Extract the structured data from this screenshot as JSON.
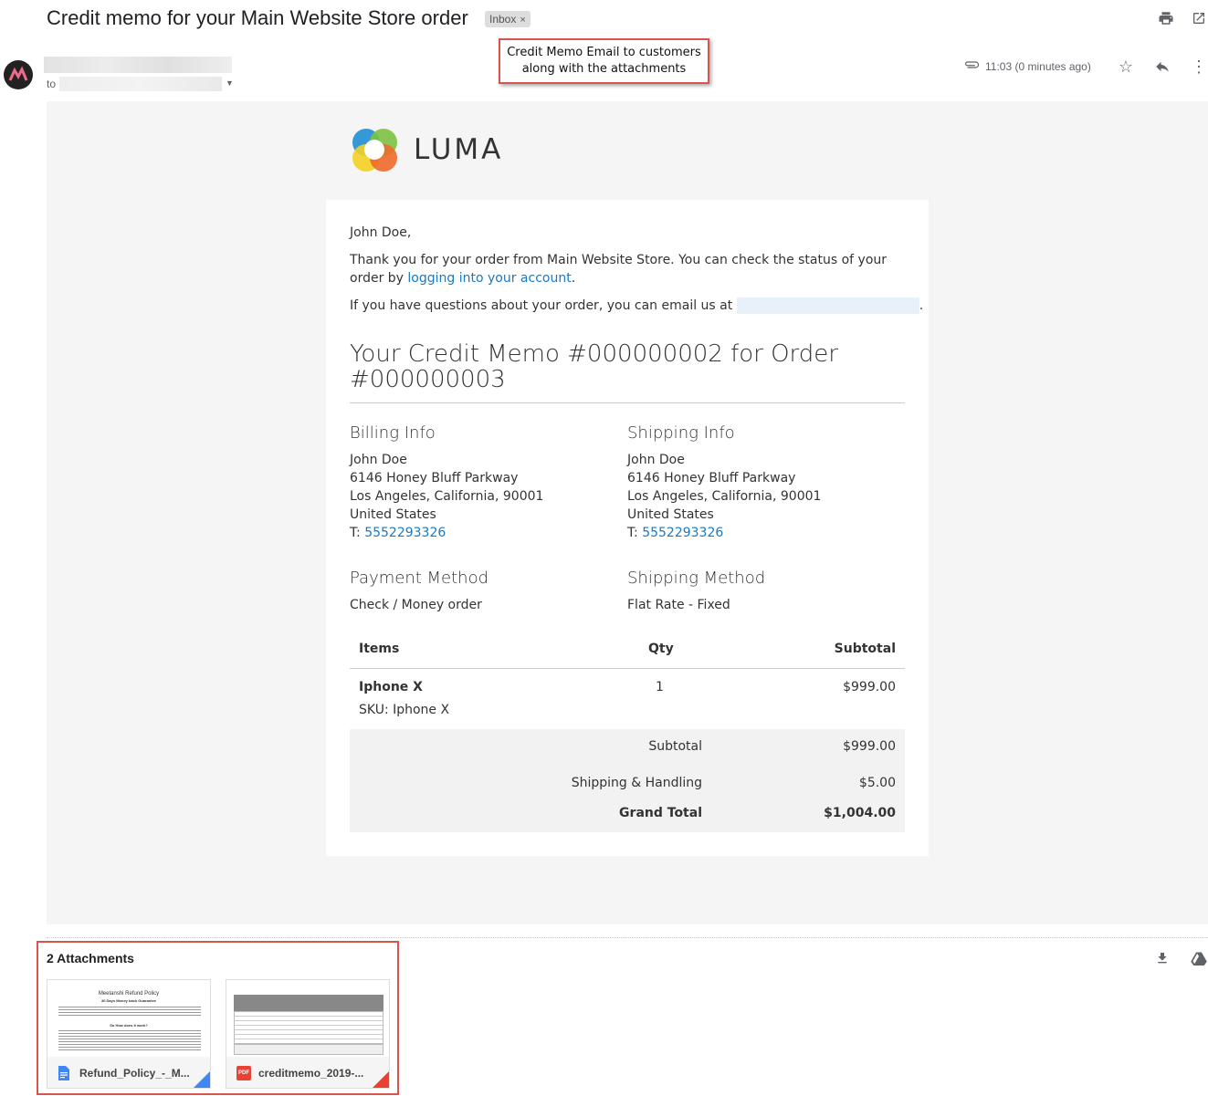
{
  "email": {
    "subject": "Credit memo for your Main Website Store order",
    "label": "Inbox",
    "label_close": "×",
    "to_prefix": "to",
    "time": "11:03 (0 minutes ago)"
  },
  "callout": {
    "line1": "Credit Memo Email to customers",
    "line2": "along with the attachments"
  },
  "logo": {
    "text": "LUMA"
  },
  "body": {
    "greeting": "John Doe,",
    "thanks": "Thank you for your order from Main Website Store. You can check the status of your order by",
    "login_link": "logging into your account",
    "login_suffix": ".",
    "questions": "If you have questions about your order, you can email us at",
    "questions_suffix": ".",
    "memo_title": "Your Credit Memo #000000002 for Order #000000003"
  },
  "billing": {
    "heading": "Billing Info",
    "name": "John Doe",
    "street": "6146 Honey Bluff Parkway",
    "city": "Los Angeles, California, 90001",
    "country": "United States",
    "phone_prefix": "T:",
    "phone": "5552293326"
  },
  "shipping": {
    "heading": "Shipping Info",
    "name": "John Doe",
    "street": "6146 Honey Bluff Parkway",
    "city": "Los Angeles, California, 90001",
    "country": "United States",
    "phone_prefix": "T:",
    "phone": "5552293326"
  },
  "payment": {
    "heading": "Payment Method",
    "value": "Check / Money order"
  },
  "shipping_method": {
    "heading": "Shipping Method",
    "value": "Flat Rate - Fixed"
  },
  "table": {
    "headers": {
      "items": "Items",
      "qty": "Qty",
      "subtotal": "Subtotal"
    },
    "row": {
      "name": "Iphone X",
      "sku": "SKU: Iphone X",
      "qty": "1",
      "subtotal": "$999.00"
    },
    "totals": {
      "subtotal_label": "Subtotal",
      "subtotal_value": "$999.00",
      "shipping_label": "Shipping & Handling",
      "shipping_value": "$5.00",
      "grand_label": "Grand Total",
      "grand_value": "$1,004.00"
    }
  },
  "attachments": {
    "title": "2 Attachments",
    "files": [
      {
        "name": "Refund_Policy_-_M...",
        "type_icon": "doc-icon",
        "preview_title": "Meetanshi Refund Policy",
        "preview_sub": "30 Days Money back Guarantee",
        "preview_q": "So How does it work?"
      },
      {
        "name": "creditmemo_2019-...",
        "type_icon": "pdf-icon",
        "type_label": "PDF"
      }
    ]
  },
  "colors": {
    "accent_link": "#1979c3",
    "highlight_border": "#d9534f"
  }
}
